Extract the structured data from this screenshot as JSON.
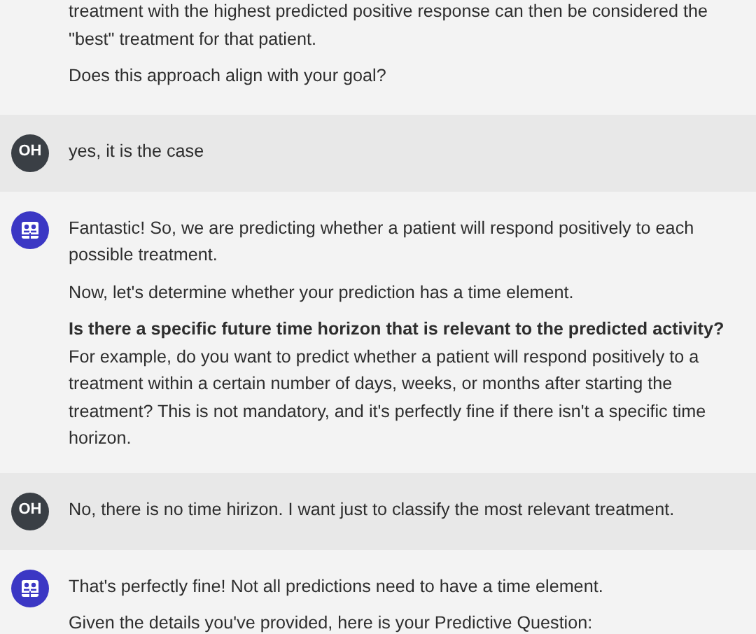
{
  "messages": [
    {
      "kind": "assistant",
      "paragraphs": [
        {
          "text": "treatment with the highest predicted positive response can then be considered the \"best\" treatment for that patient."
        },
        {
          "text": "Does this approach align with your goal?"
        }
      ]
    },
    {
      "kind": "user",
      "avatar": "OH",
      "paragraphs": [
        {
          "text": "yes, it is the case"
        }
      ]
    },
    {
      "kind": "assistant",
      "paragraphs": [
        {
          "text": "Fantastic! So, we are predicting whether a patient will respond positively to each possible treatment."
        },
        {
          "text": "Now, let's determine whether your prediction has a time element."
        },
        {
          "lead": "Is there a specific future time horizon that is relevant to the predicted activity?",
          "text": "For example, do you want to predict whether a patient will respond positively to a treatment within a certain number of days, weeks, or months after starting the treatment? This is not mandatory, and it's perfectly fine if there isn't a specific time horizon."
        }
      ]
    },
    {
      "kind": "user",
      "avatar": "OH",
      "paragraphs": [
        {
          "text": "No, there is no time hirizon. I want just to classify the most relevant treatment."
        }
      ]
    },
    {
      "kind": "assistant",
      "paragraphs": [
        {
          "text": "That's perfectly fine! Not all predictions need to have a time element."
        },
        {
          "text": "Given the details you've provided, here is your Predictive Question:"
        }
      ]
    }
  ]
}
